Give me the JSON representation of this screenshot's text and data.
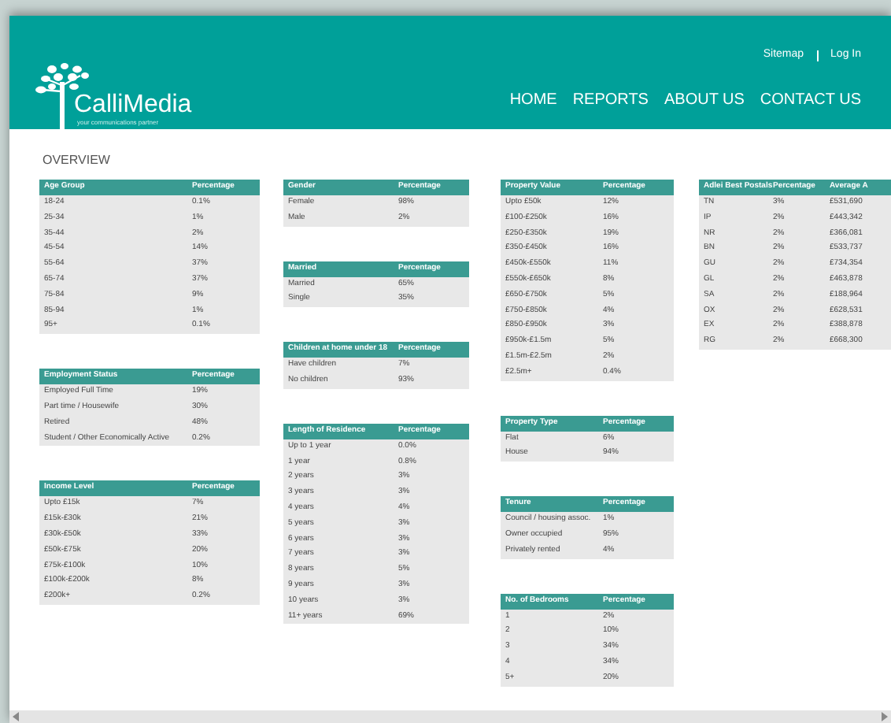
{
  "header": {
    "logo_name": "CalliMedia",
    "logo_tagline": "your communications partner",
    "top_links": [
      "Sitemap",
      "Log In"
    ],
    "nav": [
      "HOME",
      "REPORTS",
      "ABOUT US",
      "CONTACT US"
    ]
  },
  "page_title": "OVERVIEW",
  "columns": [
    [
      {
        "header": [
          "Age Group",
          "Percentage"
        ],
        "rows": [
          [
            "18-24",
            "0.1%"
          ],
          [
            "25-34",
            "1%"
          ],
          [
            "35-44",
            "2%"
          ],
          [
            "45-54",
            "14%"
          ],
          [
            "55-64",
            "37%"
          ],
          [
            "65-74",
            "37%"
          ],
          [
            "75-84",
            "9%"
          ],
          [
            "85-94",
            "1%"
          ],
          [
            "95+",
            "0.1%"
          ]
        ]
      },
      {
        "header": [
          "Employment Status",
          "Percentage"
        ],
        "rows": [
          [
            "Employed Full Time",
            "19%"
          ],
          [
            "Part time / Housewife",
            "30%"
          ],
          [
            "Retired",
            "48%"
          ],
          [
            "Student / Other Economically Active",
            "0.2%"
          ]
        ]
      },
      {
        "header": [
          "Income Level",
          "Percentage"
        ],
        "rows": [
          [
            "Upto £15k",
            "7%"
          ],
          [
            "£15k-£30k",
            "21%"
          ],
          [
            "£30k-£50k",
            "33%"
          ],
          [
            "£50k-£75k",
            "20%"
          ],
          [
            "£75k-£100k",
            "10%"
          ],
          [
            "£100k-£200k",
            "8%"
          ],
          [
            "£200k+",
            "0.2%"
          ]
        ]
      }
    ],
    [
      {
        "header": [
          "Gender",
          "Percentage"
        ],
        "rows": [
          [
            "Female",
            "98%"
          ],
          [
            "Male",
            "2%"
          ]
        ]
      },
      {
        "header": [
          "Married",
          "Percentage"
        ],
        "rows": [
          [
            "Married",
            "65%"
          ],
          [
            "Single",
            "35%"
          ]
        ]
      },
      {
        "header": [
          "Children at home under 18",
          "Percentage"
        ],
        "rows": [
          [
            "Have children",
            "7%"
          ],
          [
            "No children",
            "93%"
          ]
        ]
      },
      {
        "header": [
          "Length of Residence",
          "Percentage"
        ],
        "rows": [
          [
            "Up to 1 year",
            "0.0%"
          ],
          [
            "1 year",
            "0.8%"
          ],
          [
            "2 years",
            "3%"
          ],
          [
            "3 years",
            "3%"
          ],
          [
            "4 years",
            "4%"
          ],
          [
            "5 years",
            "3%"
          ],
          [
            "6 years",
            "3%"
          ],
          [
            "7 years",
            "3%"
          ],
          [
            "8 years",
            "5%"
          ],
          [
            "9 years",
            "3%"
          ],
          [
            "10 years",
            "3%"
          ],
          [
            "11+ years",
            "69%"
          ]
        ]
      }
    ],
    [
      {
        "header": [
          "Property Value",
          "Percentage"
        ],
        "rows": [
          [
            "Upto £50k",
            "12%"
          ],
          [
            "£100-£250k",
            "16%"
          ],
          [
            "£250-£350k",
            "19%"
          ],
          [
            "£350-£450k",
            "16%"
          ],
          [
            "£450k-£550k",
            "11%"
          ],
          [
            "£550k-£650k",
            "8%"
          ],
          [
            "£650-£750k",
            "5%"
          ],
          [
            "£750-£850k",
            "4%"
          ],
          [
            "£850-£950k",
            "3%"
          ],
          [
            "£950k-£1.5m",
            "5%"
          ],
          [
            "£1.5m-£2.5m",
            "2%"
          ],
          [
            "£2.5m+",
            "0.4%"
          ]
        ]
      },
      {
        "header": [
          "Property Type",
          "Percentage"
        ],
        "rows": [
          [
            "Flat",
            "6%"
          ],
          [
            "House",
            "94%"
          ]
        ]
      },
      {
        "header": [
          "Tenure",
          "Percentage"
        ],
        "rows": [
          [
            "Council / housing assoc.",
            "1%"
          ],
          [
            "Owner occupied",
            "95%"
          ],
          [
            "Privately rented",
            "4%"
          ]
        ]
      },
      {
        "header": [
          "No. of Bedrooms",
          "Percentage"
        ],
        "rows": [
          [
            "1",
            "2%"
          ],
          [
            "2",
            "10%"
          ],
          [
            "3",
            "34%"
          ],
          [
            "4",
            "34%"
          ],
          [
            "5+",
            "20%"
          ]
        ]
      }
    ],
    [
      {
        "header": [
          "Adlei Best Postals",
          "Percentage",
          "Average A"
        ],
        "rows": [
          [
            "TN",
            "3%",
            "£531,690"
          ],
          [
            "IP",
            "2%",
            "£443,342"
          ],
          [
            "NR",
            "2%",
            "£366,081"
          ],
          [
            "BN",
            "2%",
            "£533,737"
          ],
          [
            "GU",
            "2%",
            "£734,354"
          ],
          [
            "GL",
            "2%",
            "£463,878"
          ],
          [
            "SA",
            "2%",
            "£188,964"
          ],
          [
            "OX",
            "2%",
            "£628,531"
          ],
          [
            "EX",
            "2%",
            "£388,878"
          ],
          [
            "RG",
            "2%",
            "£668,300"
          ]
        ]
      }
    ]
  ]
}
